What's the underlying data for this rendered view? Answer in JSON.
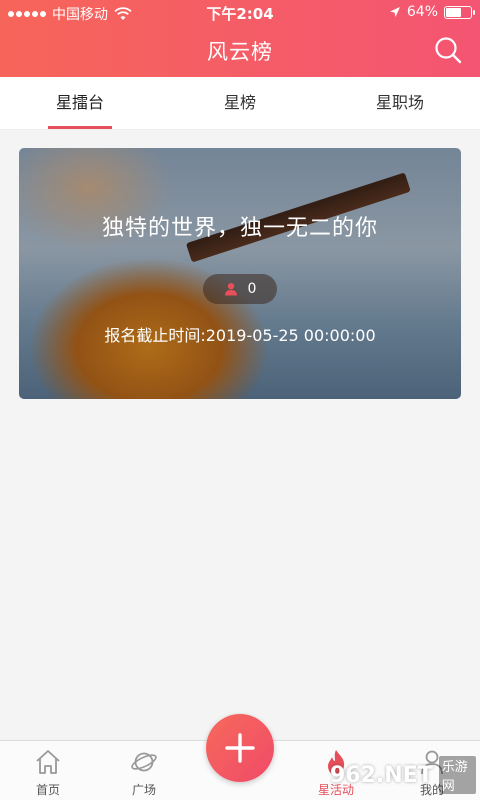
{
  "status_bar": {
    "carrier": "中国移动",
    "time": "下午2:04",
    "battery": "64%",
    "battery_level": 0.64
  },
  "nav": {
    "title": "风云榜"
  },
  "tabs": [
    {
      "label": "星擂台",
      "active": true
    },
    {
      "label": "星榜",
      "active": false
    },
    {
      "label": "星职场",
      "active": false
    }
  ],
  "card": {
    "title": "独特的世界，独一无二的你",
    "count": "0",
    "deadline": "报名截止时间:2019-05-25 00:00:00"
  },
  "bottom_nav": [
    {
      "label": "首页",
      "icon": "home-icon"
    },
    {
      "label": "广场",
      "icon": "planet-icon"
    },
    {
      "label": "星活动",
      "icon": "flame-icon",
      "active": true
    },
    {
      "label": "我的",
      "icon": "user-icon"
    }
  ],
  "fab": {
    "icon": "plus-icon"
  },
  "watermark": {
    "logo": "962.NET",
    "sub": "乐游网"
  },
  "colors": {
    "accent": "#e74f5a",
    "header_start": "#f6655a",
    "header_end": "#f45572"
  }
}
